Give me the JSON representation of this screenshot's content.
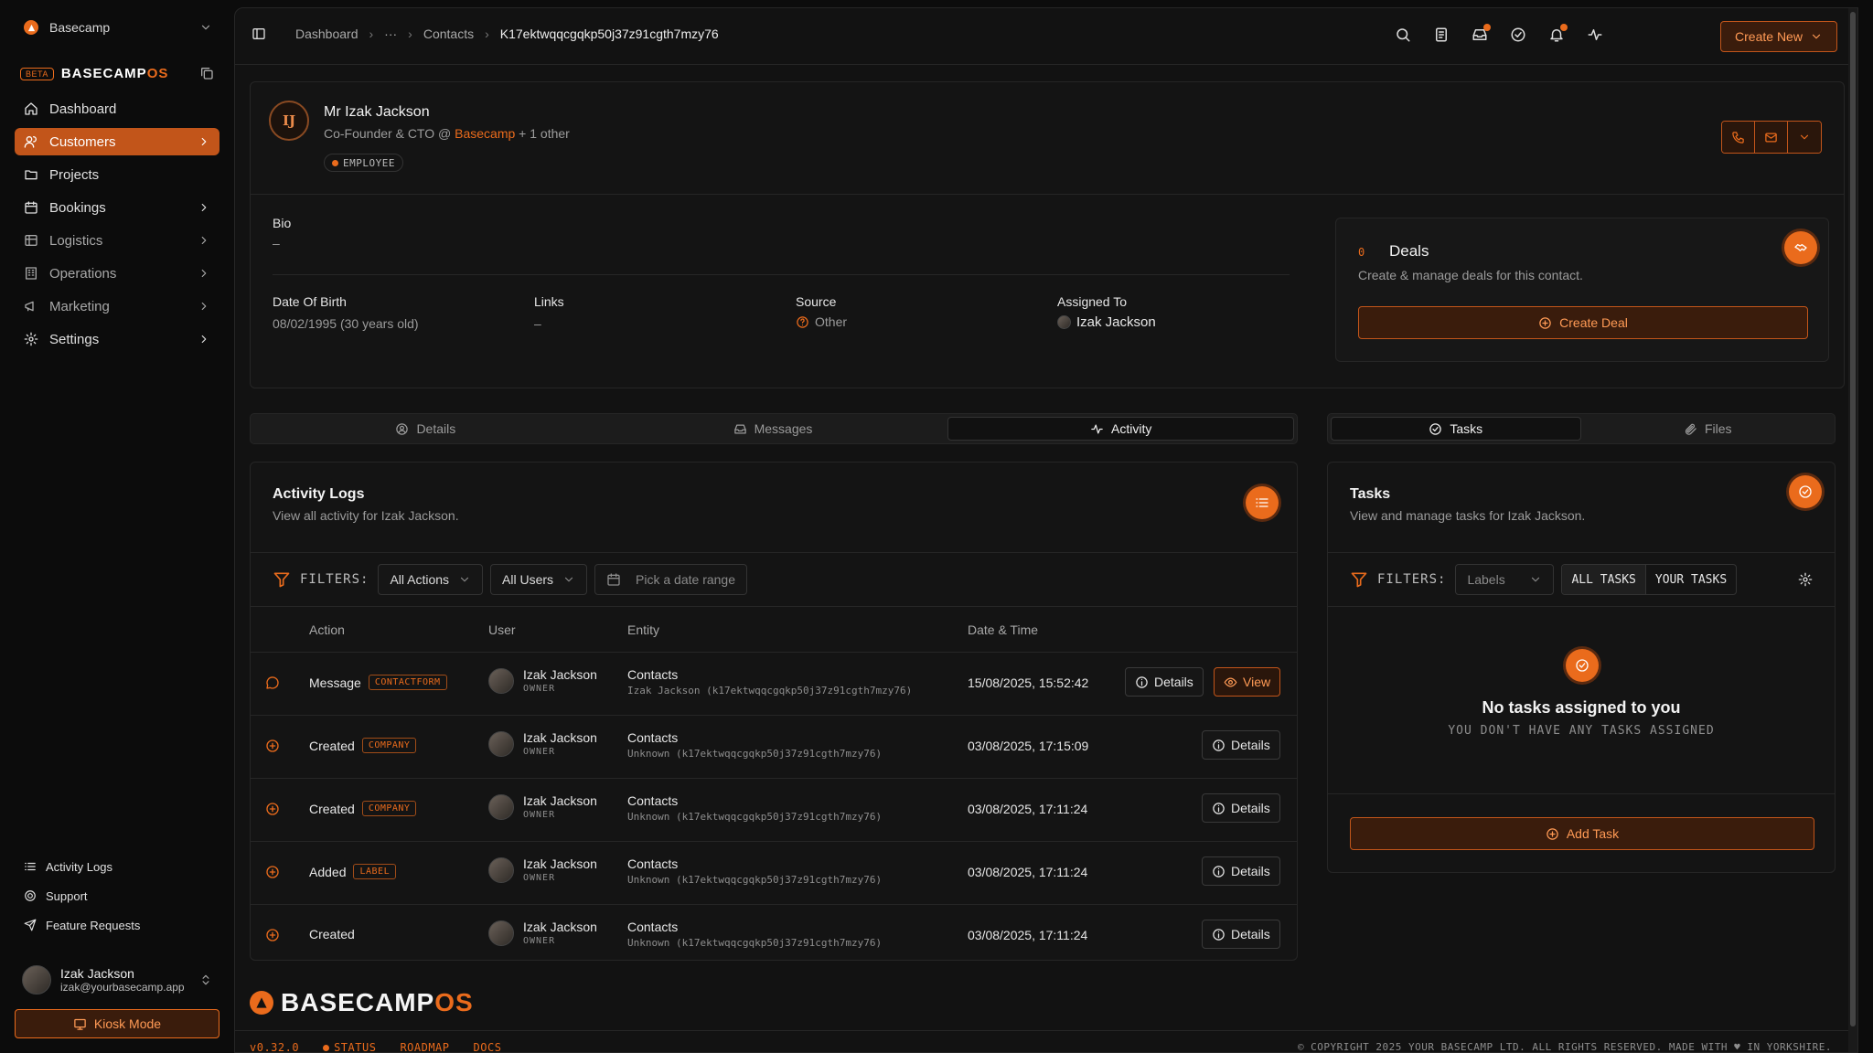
{
  "workspace": {
    "name": "Basecamp"
  },
  "brand": {
    "beta": "BETA",
    "name_main": "BASECAMP",
    "name_accent": "OS"
  },
  "sidebar": {
    "items": [
      {
        "label": "Dashboard",
        "icon": "home-icon"
      },
      {
        "label": "Customers",
        "icon": "users-icon",
        "active": true
      },
      {
        "label": "Projects",
        "icon": "folder-icon"
      },
      {
        "label": "Bookings",
        "icon": "calendar-icon"
      },
      {
        "label": "Logistics",
        "icon": "truck-icon"
      },
      {
        "label": "Operations",
        "icon": "building-icon"
      },
      {
        "label": "Marketing",
        "icon": "megaphone-icon"
      },
      {
        "label": "Settings",
        "icon": "gear-icon"
      }
    ],
    "bottom": [
      {
        "label": "Activity Logs"
      },
      {
        "label": "Support"
      },
      {
        "label": "Feature Requests"
      }
    ],
    "user": {
      "name": "Izak Jackson",
      "email": "izak@yourbasecamp.app"
    },
    "kiosk": "Kiosk Mode"
  },
  "breadcrumb": {
    "c1": "Dashboard",
    "c2": "···",
    "c3": "Contacts",
    "c4": "K17ektwqqcgqkp50j37z91cgth7mzy76"
  },
  "topbar": {
    "create_new": "Create New"
  },
  "contact": {
    "initials": "IJ",
    "name": "Mr Izak Jackson",
    "role_prefix": "Co-Founder & CTO @ ",
    "org": "Basecamp",
    "role_suffix": " + 1 other",
    "badge": "EMPLOYEE",
    "bio_label": "Bio",
    "bio_value": "–",
    "dob_label": "Date Of Birth",
    "dob_value": "08/02/1995 (30 years old)",
    "links_label": "Links",
    "links_value": "–",
    "source_label": "Source",
    "source_value": "Other",
    "assigned_label": "Assigned To",
    "assigned_value": "Izak Jackson"
  },
  "deals": {
    "count": "0",
    "title": "Deals",
    "subtitle": "Create & manage deals for this contact.",
    "button": "Create Deal"
  },
  "tabs_left": [
    {
      "label": "Details"
    },
    {
      "label": "Messages"
    },
    {
      "label": "Activity"
    }
  ],
  "tabs_right": [
    {
      "label": "Tasks"
    },
    {
      "label": "Files"
    }
  ],
  "activity": {
    "title": "Activity Logs",
    "subtitle": "View all activity for Izak Jackson.",
    "filters_label": "FILTERS:",
    "filter_actions": "All Actions",
    "filter_users": "All Users",
    "date_placeholder": "Pick a date range",
    "columns": {
      "action": "Action",
      "user": "User",
      "entity": "Entity",
      "datetime": "Date & Time"
    },
    "details_label": "Details",
    "view_label": "View",
    "rows": [
      {
        "action": "Message",
        "tag": "CONTACTFORM",
        "user": "Izak Jackson",
        "role": "OWNER",
        "entity": "Contacts",
        "entity_sub": "Izak Jackson (k17ektwqqcgqkp50j37z91cgth7mzy76)",
        "datetime": "15/08/2025, 15:52:42"
      },
      {
        "action": "Created",
        "tag": "COMPANY",
        "user": "Izak Jackson",
        "role": "OWNER",
        "entity": "Contacts",
        "entity_sub": "Unknown (k17ektwqqcgqkp50j37z91cgth7mzy76)",
        "datetime": "03/08/2025, 17:15:09"
      },
      {
        "action": "Created",
        "tag": "COMPANY",
        "user": "Izak Jackson",
        "role": "OWNER",
        "entity": "Contacts",
        "entity_sub": "Unknown (k17ektwqqcgqkp50j37z91cgth7mzy76)",
        "datetime": "03/08/2025, 17:11:24"
      },
      {
        "action": "Added",
        "tag": "LABEL",
        "user": "Izak Jackson",
        "role": "OWNER",
        "entity": "Contacts",
        "entity_sub": "Unknown (k17ektwqqcgqkp50j37z91cgth7mzy76)",
        "datetime": "03/08/2025, 17:11:24"
      },
      {
        "action": "Created",
        "tag": "",
        "user": "Izak Jackson",
        "role": "OWNER",
        "entity": "Contacts",
        "entity_sub": "Unknown (k17ektwqqcgqkp50j37z91cgth7mzy76)",
        "datetime": "03/08/2025, 17:11:24"
      }
    ]
  },
  "tasks": {
    "title": "Tasks",
    "subtitle": "View and manage tasks for Izak Jackson.",
    "filters_label": "FILTERS:",
    "labels_placeholder": "Labels",
    "all_tasks": "ALL TASKS",
    "your_tasks": "YOUR TASKS",
    "empty_title": "No tasks assigned to you",
    "empty_sub": "YOU DON'T HAVE ANY TASKS ASSIGNED",
    "add_button": "Add Task"
  },
  "footer": {
    "logo_main": "BASECAMP",
    "logo_accent": "OS",
    "version": "v0.32.0",
    "status": "STATUS",
    "roadmap": "ROADMAP",
    "docs": "DOCS",
    "copyright": "© COPYRIGHT 2025 YOUR BASECAMP LTD. ALL RIGHTS RESERVED. MADE WITH ♥ IN YORKSHIRE."
  },
  "colors": {
    "accent": "#ea6b1c",
    "accent_dark": "#c2551a",
    "background": "#0c0c0c",
    "surface": "#141414"
  }
}
